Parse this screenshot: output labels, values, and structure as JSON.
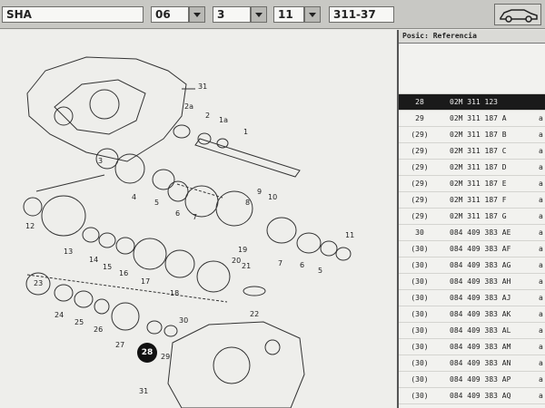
{
  "header": {
    "model_value": "SHA",
    "year_value": "06",
    "group_value": "3",
    "subgroup_value": "11",
    "illustration_value": "311-37"
  },
  "parts_list": {
    "header_pos": "Posic",
    "header_ref": "Referencia",
    "rows": [
      {
        "pos": "28",
        "ref": "02M 311 123",
        "sfx": "",
        "ext": ""
      },
      {
        "pos": "29",
        "ref": "02M 311 187 A",
        "sfx": "A",
        "ext": "a"
      },
      {
        "pos": "(29)",
        "ref": "02M 311 187 B",
        "sfx": "B",
        "ext": "a"
      },
      {
        "pos": "(29)",
        "ref": "02M 311 187 C",
        "sfx": "C",
        "ext": "a"
      },
      {
        "pos": "(29)",
        "ref": "02M 311 187 D",
        "sfx": "D",
        "ext": "a"
      },
      {
        "pos": "(29)",
        "ref": "02M 311 187 E",
        "sfx": "E",
        "ext": "a"
      },
      {
        "pos": "(29)",
        "ref": "02M 311 187 F",
        "sfx": "F",
        "ext": "a"
      },
      {
        "pos": "(29)",
        "ref": "02M 311 187 G",
        "sfx": "G",
        "ext": "a"
      },
      {
        "pos": "30",
        "ref": "084 409 383 AE",
        "sfx": "AE",
        "ext": "a"
      },
      {
        "pos": "(30)",
        "ref": "084 409 383 AF",
        "sfx": "AF",
        "ext": "a"
      },
      {
        "pos": "(30)",
        "ref": "084 409 383 AG",
        "sfx": "AG",
        "ext": "a"
      },
      {
        "pos": "(30)",
        "ref": "084 409 383 AH",
        "sfx": "AH",
        "ext": "a"
      },
      {
        "pos": "(30)",
        "ref": "084 409 383 AJ",
        "sfx": "AJ",
        "ext": "a"
      },
      {
        "pos": "(30)",
        "ref": "084 409 383 AK",
        "sfx": "AK",
        "ext": "a"
      },
      {
        "pos": "(30)",
        "ref": "084 409 383 AL",
        "sfx": "AL",
        "ext": "a"
      },
      {
        "pos": "(30)",
        "ref": "084 409 383 AM",
        "sfx": "AM",
        "ext": "a"
      },
      {
        "pos": "(30)",
        "ref": "084 409 383 AN",
        "sfx": "AN",
        "ext": "a"
      },
      {
        "pos": "(30)",
        "ref": "084 409 383 AP",
        "sfx": "AP",
        "ext": "a"
      },
      {
        "pos": "(30)",
        "ref": "084 409 383 AQ",
        "sfx": "AQ",
        "ext": "a"
      }
    ]
  },
  "diagram": {
    "labels": [
      "31",
      "2a",
      "2",
      "1a",
      "1",
      "3",
      "4",
      "5",
      "6",
      "7",
      "8",
      "9",
      "10",
      "12",
      "13",
      "14",
      "15",
      "16",
      "17",
      "18",
      "19",
      "20",
      "21",
      "22",
      "7",
      "6",
      "5",
      "11",
      "23",
      "24",
      "25",
      "26",
      "27",
      "28",
      "29",
      "30",
      "31"
    ],
    "highlighted_position": "28"
  },
  "icons": {
    "car": "car-icon",
    "dropdown": "chevron-down-icon"
  },
  "colors": {
    "selected_row": "#1a1a1a",
    "list_bg": "#f2f2ef",
    "highlight_badge": "#111111"
  }
}
